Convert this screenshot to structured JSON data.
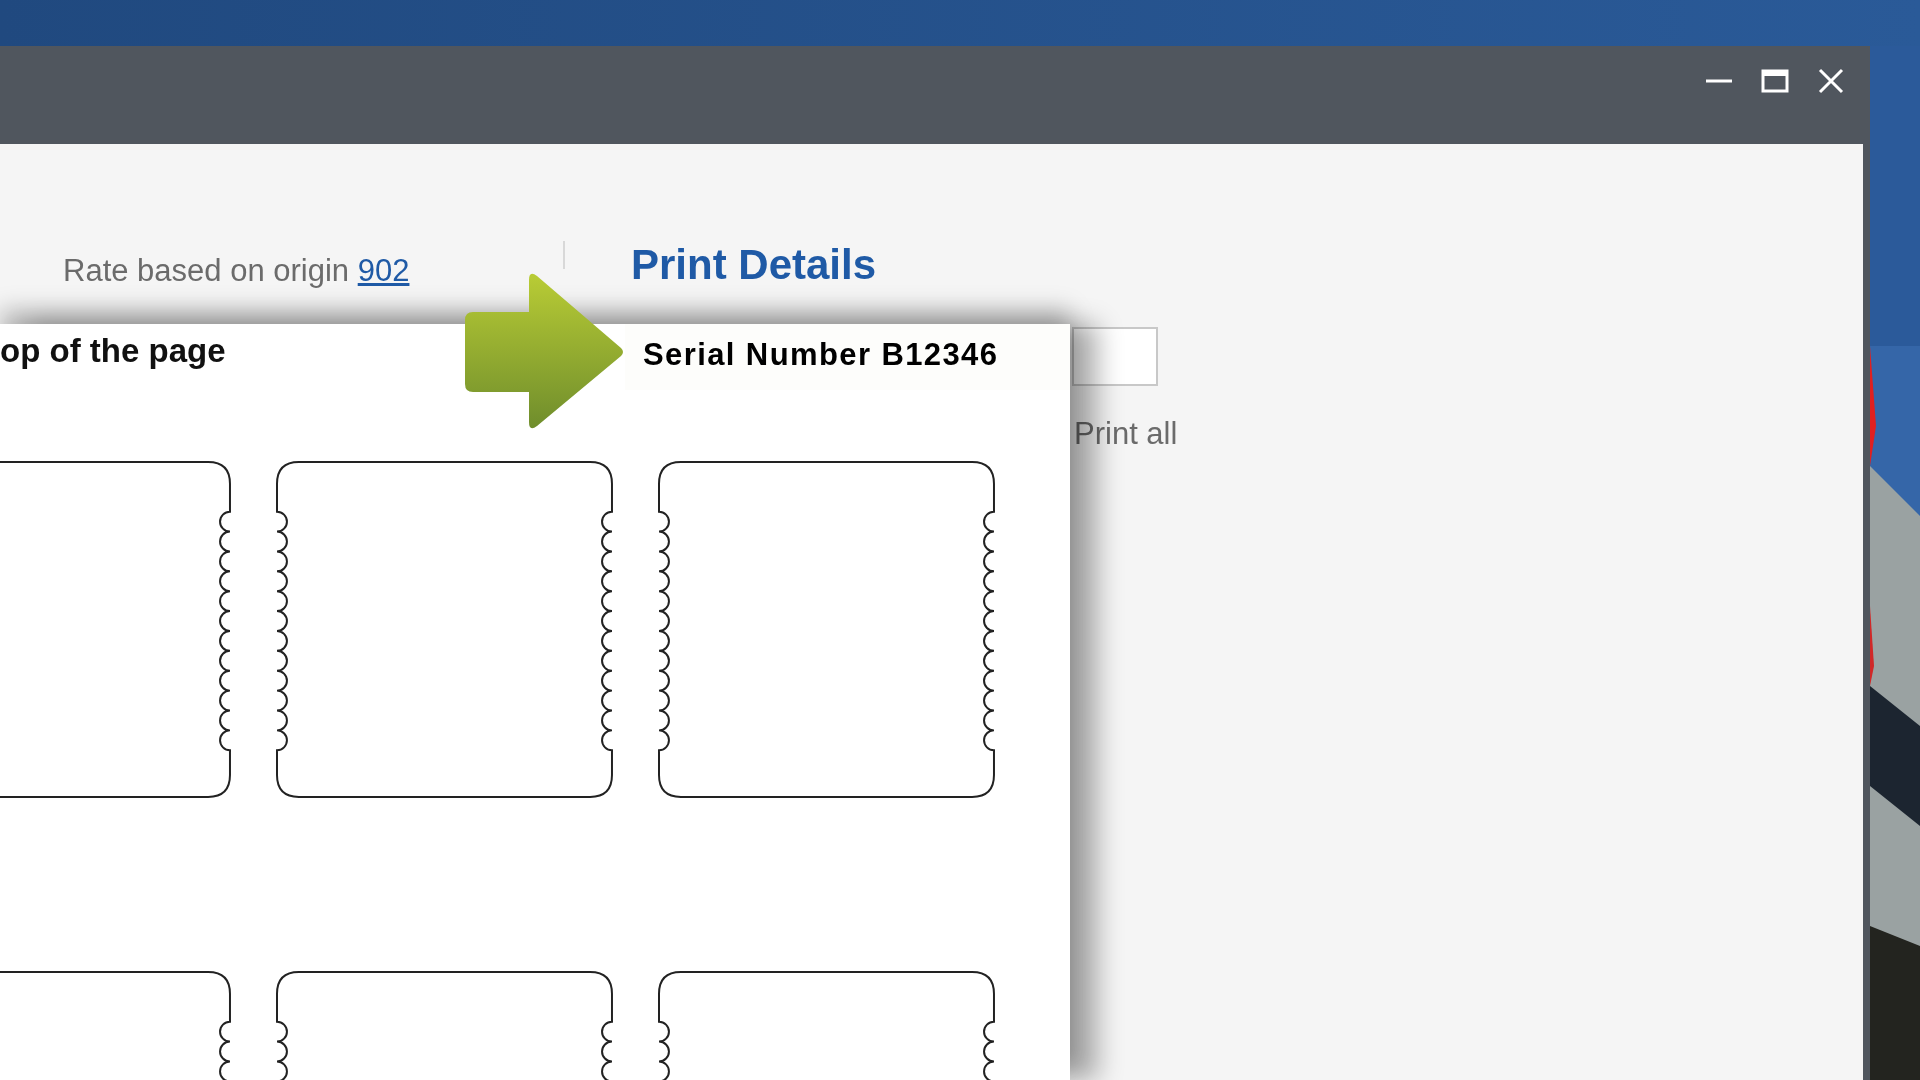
{
  "window": {
    "controls": [
      {
        "kind": "minimize"
      },
      {
        "kind": "maximize"
      },
      {
        "kind": "close"
      }
    ]
  },
  "form": {
    "rate_text": "Rate based on origin ",
    "rate_link": "902",
    "heading": "Print Details",
    "print_all": "Print all"
  },
  "callout": {
    "page_heading": "op of the page",
    "serial_label": "Serial Number B12346"
  }
}
